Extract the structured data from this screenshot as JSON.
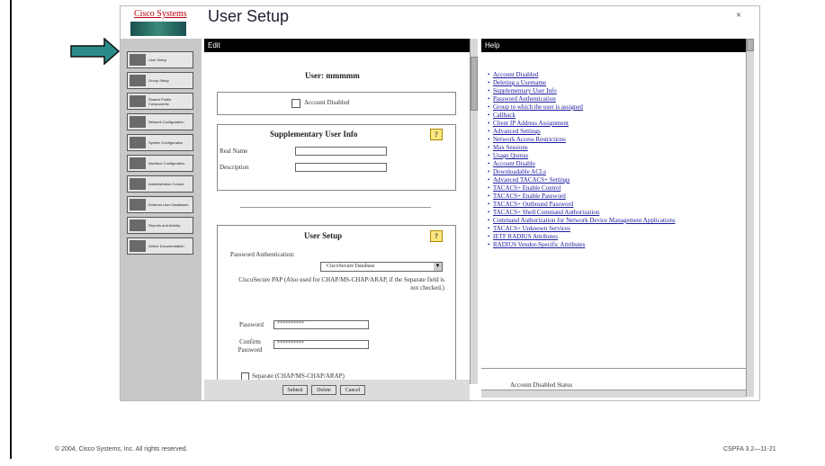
{
  "window": {
    "title": "User Setup",
    "logo_text": "Cisco Systems",
    "close_glyph": "×"
  },
  "sidebar": {
    "items": [
      {
        "label": "User Setup",
        "icon": "user-icon"
      },
      {
        "label": "Group Setup",
        "icon": "group-icon"
      },
      {
        "label": "Shared Profile Components",
        "icon": "shared-profile-icon"
      },
      {
        "label": "Network Configuration",
        "icon": "network-icon"
      },
      {
        "label": "System Configuration",
        "icon": "system-icon"
      },
      {
        "label": "Interface Configuration",
        "icon": "interface-icon"
      },
      {
        "label": "Administration Control",
        "icon": "admin-icon"
      },
      {
        "label": "External User Databases",
        "icon": "database-icon"
      },
      {
        "label": "Reports and Activity",
        "icon": "reports-icon"
      },
      {
        "label": "Online Documentation",
        "icon": "documentation-icon"
      }
    ]
  },
  "edit": {
    "header": "Edit",
    "user_heading": "User: mmmmm",
    "account_disabled_label": "Account Disabled",
    "supplementary": {
      "title": "Supplementary User Info",
      "real_name_label": "Real Name",
      "description_label": "Description"
    },
    "user_setup": {
      "title": "User Setup",
      "password_auth_label": "Password Authentication:",
      "password_auth_value": "CiscoSecure Database",
      "note": "CiscoSecure PAP (Also used for CHAP/MS-CHAP/ARAP, if the Separate field is not checked.)",
      "password_label": "Password",
      "password_value": "**********",
      "confirm_label": "Confirm Password",
      "confirm_value": "**********",
      "separate_label": "Separate (CHAP/MS-CHAP/ARAP)"
    },
    "buttons": {
      "submit": "Submit",
      "delete": "Delete",
      "cancel": "Cancel"
    }
  },
  "help": {
    "header": "Help",
    "links": [
      "Account Disabled",
      "Deleting a Username",
      "Supplementary User Info",
      "Password Authentication",
      "Group to which the user is assigned",
      "Callback",
      "Client IP Address Assignment",
      "Advanced Settings",
      "Network Access Restrictions",
      "Max Sessions",
      "Usage Quotas",
      "Account Disable",
      "Downloadable ACLs",
      "Advanced TACACS+ Settings",
      "TACACS+ Enable Control",
      "TACACS+ Enable Password",
      "TACACS+ Outbound Password",
      "TACACS+ Shell Command Authorization",
      "Command Authorization for Network Device Management Applications",
      "TACACS+ Unknown Services",
      "IETF RADIUS Attributes",
      "RADIUS Vendor-Specific Attributes"
    ],
    "bottom_text": "Account Disabled Status"
  },
  "footer": {
    "copyright": "© 2004, Cisco Systems, Inc. All rights reserved.",
    "code": "CSPFA 3.2—11-21"
  },
  "colors": {
    "arrow": "#2a8c88",
    "link": "#1a1aa0",
    "sidebar": "#c8c8c8",
    "header": "#000000"
  }
}
